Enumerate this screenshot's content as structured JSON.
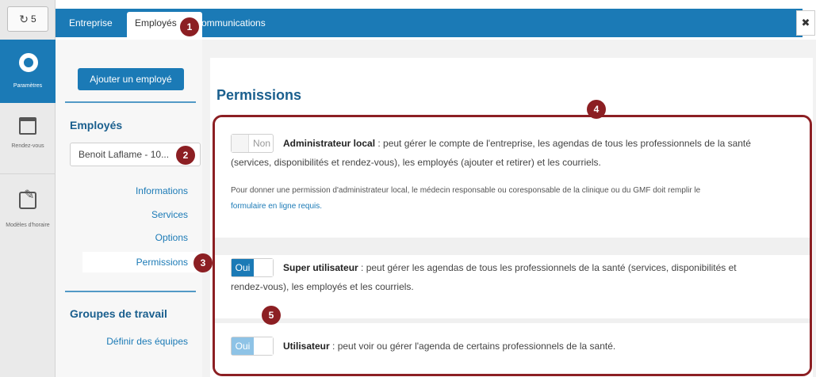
{
  "topbar": {
    "refresh_icon": "refresh-icon",
    "refresh_count": "5",
    "tabs": [
      {
        "label": "Entreprise"
      },
      {
        "label": "Employés"
      },
      {
        "label": "ommunications"
      }
    ],
    "close_label": "✖"
  },
  "rail": {
    "items": [
      {
        "label": "Paramètres",
        "icon": "gear-icon",
        "active": true
      },
      {
        "label": "Rendez-vous",
        "icon": "calendar-icon"
      },
      {
        "label": "Modèles d'horaire",
        "icon": "edit-icon"
      }
    ]
  },
  "sidebar": {
    "add_button": "Ajouter un employé",
    "employees_heading": "Employés",
    "employee_select_value": "Benoit Laflame - 10...",
    "links": [
      "Informations",
      "Services",
      "Options",
      "Permissions"
    ],
    "groups_heading": "Groupes de travail",
    "groups_link": "Définir des équipes"
  },
  "main": {
    "title": "Permissions",
    "permissions": [
      {
        "toggle": "Non",
        "name": "Administrateur local",
        "desc_line1": " : peut gérer le compte de l'entreprise, les agendas de tous les professionnels de la santé",
        "desc_line2": "(services, disponibilités et rendez-vous), les employés (ajouter et retirer) et les courriels.",
        "note_line1": "Pour donner une permission d'administrateur local, le médecin responsable ou coresponsable de la clinique ou du GMF doit remplir le",
        "note_link": "formulaire en ligne requis."
      },
      {
        "toggle": "Oui",
        "name": "Super utilisateur",
        "desc_line1": " : peut gérer les agendas de tous les professionnels de la santé (services, disponibilités et",
        "desc_line2": "rendez-vous), les employés et les courriels."
      },
      {
        "toggle": "Oui",
        "name": "Utilisateur",
        "desc_line1": " : peut voir ou gérer l'agenda de certains professionnels de la santé."
      }
    ]
  },
  "markers": [
    "1",
    "2",
    "3",
    "4",
    "5"
  ],
  "colors": {
    "accent": "#1b7ab6",
    "marker": "#8c1f23",
    "heading": "#1a5f8e"
  }
}
